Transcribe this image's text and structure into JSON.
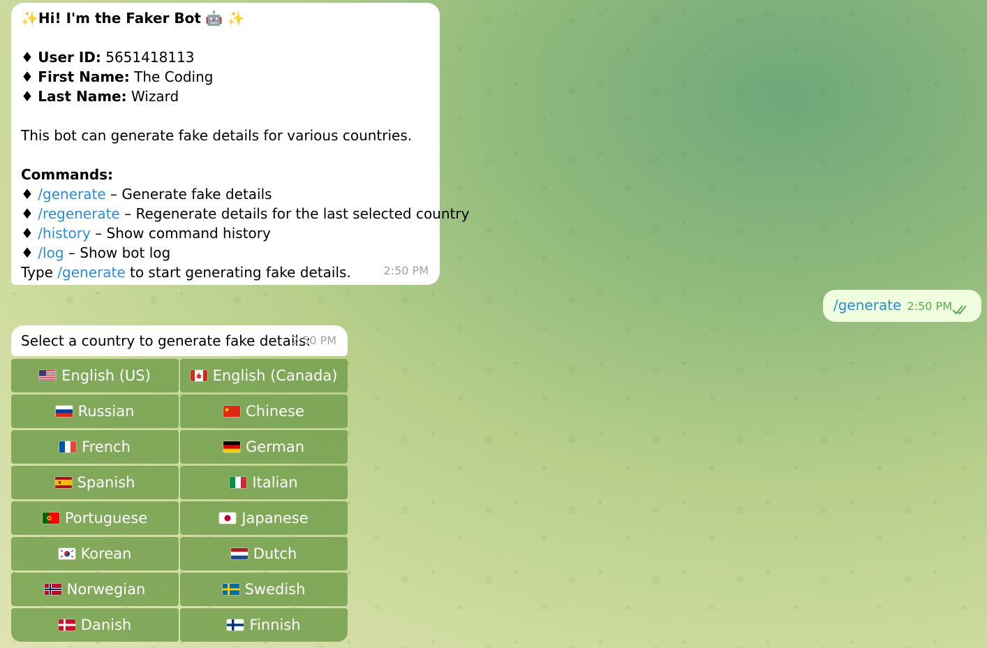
{
  "welcome": {
    "greeting_prefix": "✨",
    "greeting": "Hi! I'm the Faker Bot",
    "greeting_emoji": "🤖",
    "greeting_suffix": "✨",
    "bullet": "♦",
    "user_id_label": "User ID:",
    "user_id_value": "5651418113",
    "first_name_label": "First Name:",
    "first_name_value": "The Coding",
    "last_name_label": "Last Name:",
    "last_name_value": "Wizard",
    "description": "This bot can generate fake details for various countries.",
    "commands_title": "Commands:",
    "commands": [
      {
        "cmd": "/generate",
        "desc": " – Generate fake details"
      },
      {
        "cmd": "/regenerate",
        "desc": " – Regenerate details for the last selected country"
      },
      {
        "cmd": "/history",
        "desc": " – Show command history"
      },
      {
        "cmd": "/log",
        "desc": " – Show bot log"
      }
    ],
    "footer_prefix": "Type ",
    "footer_cmd": "/generate",
    "footer_suffix": " to start generating fake details.",
    "time": "2:50 PM"
  },
  "outgoing": {
    "text": "/generate",
    "time": "2:50 PM",
    "status_icon": "double-check-icon"
  },
  "select": {
    "text": "Select a country to generate fake details:",
    "time": "2:50 PM"
  },
  "keyboard": {
    "buttons": [
      {
        "label": "English (US)",
        "flag": "us-flag-icon"
      },
      {
        "label": "English (Canada)",
        "flag": "ca-flag-icon"
      },
      {
        "label": "Russian",
        "flag": "ru-flag-icon"
      },
      {
        "label": "Chinese",
        "flag": "cn-flag-icon"
      },
      {
        "label": "French",
        "flag": "fr-flag-icon"
      },
      {
        "label": "German",
        "flag": "de-flag-icon"
      },
      {
        "label": "Spanish",
        "flag": "es-flag-icon"
      },
      {
        "label": "Italian",
        "flag": "it-flag-icon"
      },
      {
        "label": "Portuguese",
        "flag": "pt-flag-icon"
      },
      {
        "label": "Japanese",
        "flag": "jp-flag-icon"
      },
      {
        "label": "Korean",
        "flag": "kr-flag-icon"
      },
      {
        "label": "Dutch",
        "flag": "nl-flag-icon"
      },
      {
        "label": "Norwegian",
        "flag": "no-flag-icon"
      },
      {
        "label": "Swedish",
        "flag": "se-flag-icon"
      },
      {
        "label": "Danish",
        "flag": "dk-flag-icon"
      },
      {
        "label": "Finnish",
        "flag": "fi-flag-icon"
      }
    ]
  },
  "colors": {
    "link": "#2b8dd6",
    "button_bg": "#709e4a",
    "outgoing_bg": "#effdde",
    "outgoing_time": "#5ca853"
  }
}
